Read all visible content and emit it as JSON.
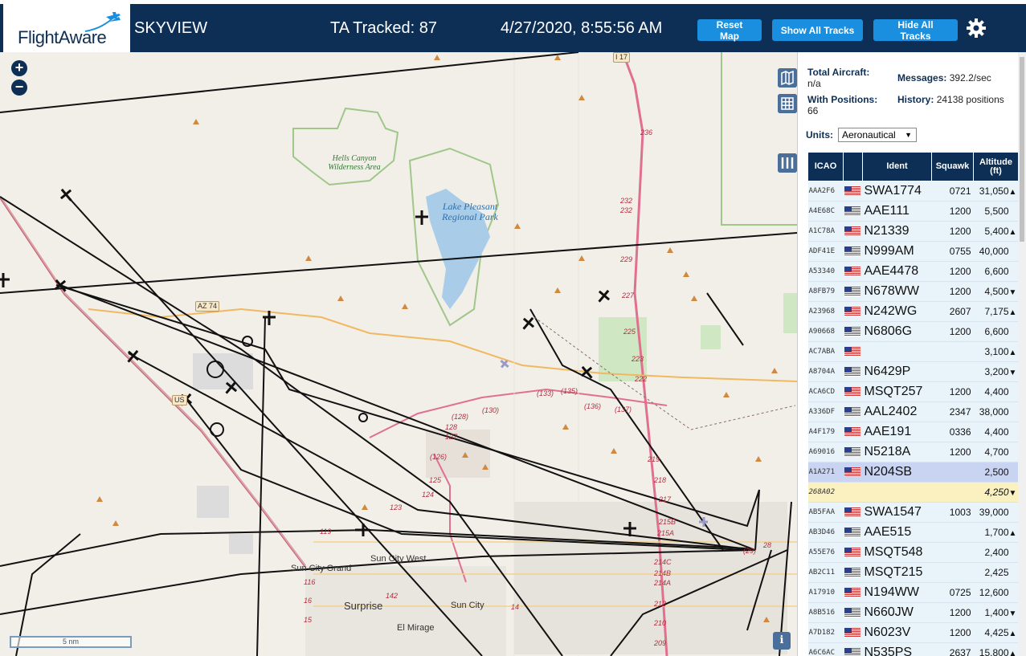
{
  "header": {
    "logo_text": "FlightAware",
    "app_title": "SKYVIEW",
    "tracked": "TA Tracked: 87",
    "clock": "4/27/2020, 8:55:56 AM",
    "reset_label": "Reset Map",
    "show_label": "Show All Tracks",
    "hide_label": "Hide All Tracks"
  },
  "map": {
    "zoom_in": "+",
    "zoom_out": "−",
    "scale": "5 nm",
    "info": "i",
    "labels": {
      "wilderness": "Hells Canyon Wilderness Area",
      "lake": "Lake Pleasant Regional Park",
      "sun_city_west": "Sun City West",
      "sun_city_grand": "Sun City Grand",
      "surprise": "Surprise",
      "sun_city": "Sun City",
      "el_mirage": "El Mirage",
      "az74": "AZ 74",
      "i17": "I 17",
      "us60": "US"
    },
    "hwy_markers": [
      "236",
      "232",
      "232",
      "229",
      "227",
      "225",
      "223",
      "222",
      "219",
      "218",
      "217",
      "215B",
      "215A",
      "214C",
      "214B",
      "214A",
      "212",
      "210",
      "209",
      "(133)",
      "(135)",
      "(136)",
      "(137)",
      "(130)",
      "(128)",
      "128",
      "127",
      "(126)",
      "125",
      "124",
      "123",
      "119",
      "116",
      "16",
      "15",
      "14",
      "142",
      "28",
      "(29)"
    ]
  },
  "panel": {
    "total_label": "Total Aircraft:",
    "total_value": "n/a",
    "messages_label": "Messages:",
    "messages_value": "392.2/sec",
    "positions_label": "With Positions:",
    "positions_value": "66",
    "history_label": "History:",
    "history_value": "24138 positions",
    "units_label": "Units:",
    "units_value": "Aeronautical",
    "columns": [
      "ICAO",
      "",
      "Ident",
      "Squawk",
      "Altitude (ft)"
    ],
    "rows": [
      {
        "icao": "AAA2F6",
        "ident": "SWA1774",
        "squawk": "0721",
        "alt": "31,050",
        "trend": "▲"
      },
      {
        "icao": "A4E68C",
        "ident": "AAE111",
        "squawk": "1200",
        "alt": "5,500",
        "trend": ""
      },
      {
        "icao": "A1C78A",
        "ident": "N21339",
        "squawk": "1200",
        "alt": "5,400",
        "trend": "▲"
      },
      {
        "icao": "ADF41E",
        "ident": "N999AM",
        "squawk": "0755",
        "alt": "40,000",
        "trend": ""
      },
      {
        "icao": "A53340",
        "ident": "AAE4478",
        "squawk": "1200",
        "alt": "6,600",
        "trend": ""
      },
      {
        "icao": "A8FB79",
        "ident": "N678WW",
        "squawk": "1200",
        "alt": "4,500",
        "trend": "▼"
      },
      {
        "icao": "A23968",
        "ident": "N242WG",
        "squawk": "2607",
        "alt": "7,175",
        "trend": "▲"
      },
      {
        "icao": "A90668",
        "ident": "N6806G",
        "squawk": "1200",
        "alt": "6,600",
        "trend": ""
      },
      {
        "icao": "AC7ABA",
        "ident": "",
        "squawk": "",
        "alt": "3,100",
        "trend": "▲"
      },
      {
        "icao": "A8704A",
        "ident": "N6429P",
        "squawk": "",
        "alt": "3,200",
        "trend": "▼"
      },
      {
        "icao": "ACA6CD",
        "ident": "MSQT257",
        "squawk": "1200",
        "alt": "4,400",
        "trend": ""
      },
      {
        "icao": "A336DF",
        "ident": "AAL2402",
        "squawk": "2347",
        "alt": "38,000",
        "trend": ""
      },
      {
        "icao": "A4F179",
        "ident": "AAE191",
        "squawk": "0336",
        "alt": "4,400",
        "trend": ""
      },
      {
        "icao": "A69016",
        "ident": "N5218A",
        "squawk": "1200",
        "alt": "4,700",
        "trend": ""
      },
      {
        "icao": "A1A271",
        "ident": "N204SB",
        "squawk": "",
        "alt": "2,500",
        "trend": "",
        "selected": true
      },
      {
        "icao": "268A02",
        "ident": "",
        "squawk": "",
        "alt": "4,250",
        "trend": "▼",
        "flag": false,
        "highlight": true
      },
      {
        "icao": "AB5FAA",
        "ident": "SWA1547",
        "squawk": "1003",
        "alt": "39,000",
        "trend": ""
      },
      {
        "icao": "AB3D46",
        "ident": "AAE515",
        "squawk": "",
        "alt": "1,700",
        "trend": "▲"
      },
      {
        "icao": "A55E76",
        "ident": "MSQT548",
        "squawk": "",
        "alt": "2,400",
        "trend": ""
      },
      {
        "icao": "AB2C11",
        "ident": "MSQT215",
        "squawk": "",
        "alt": "2,425",
        "trend": ""
      },
      {
        "icao": "A17910",
        "ident": "N194WW",
        "squawk": "0725",
        "alt": "12,600",
        "trend": ""
      },
      {
        "icao": "A8B516",
        "ident": "N660JW",
        "squawk": "1200",
        "alt": "1,400",
        "trend": "▼"
      },
      {
        "icao": "A7D182",
        "ident": "N6023V",
        "squawk": "1200",
        "alt": "4,425",
        "trend": "▲"
      },
      {
        "icao": "A6C6AC",
        "ident": "N535PS",
        "squawk": "2637",
        "alt": "15,800",
        "trend": "▲"
      }
    ]
  },
  "colors": {
    "header_bg": "#0d2f56",
    "button_bg": "#1a8fe0",
    "row_bg": "#e8f3fa",
    "row_selected": "#c9d3f2",
    "row_highlight": "#fbf0c0",
    "map_bg": "#f2efe9",
    "lake": "#a9cce8",
    "park_border": "#9fc78a"
  }
}
